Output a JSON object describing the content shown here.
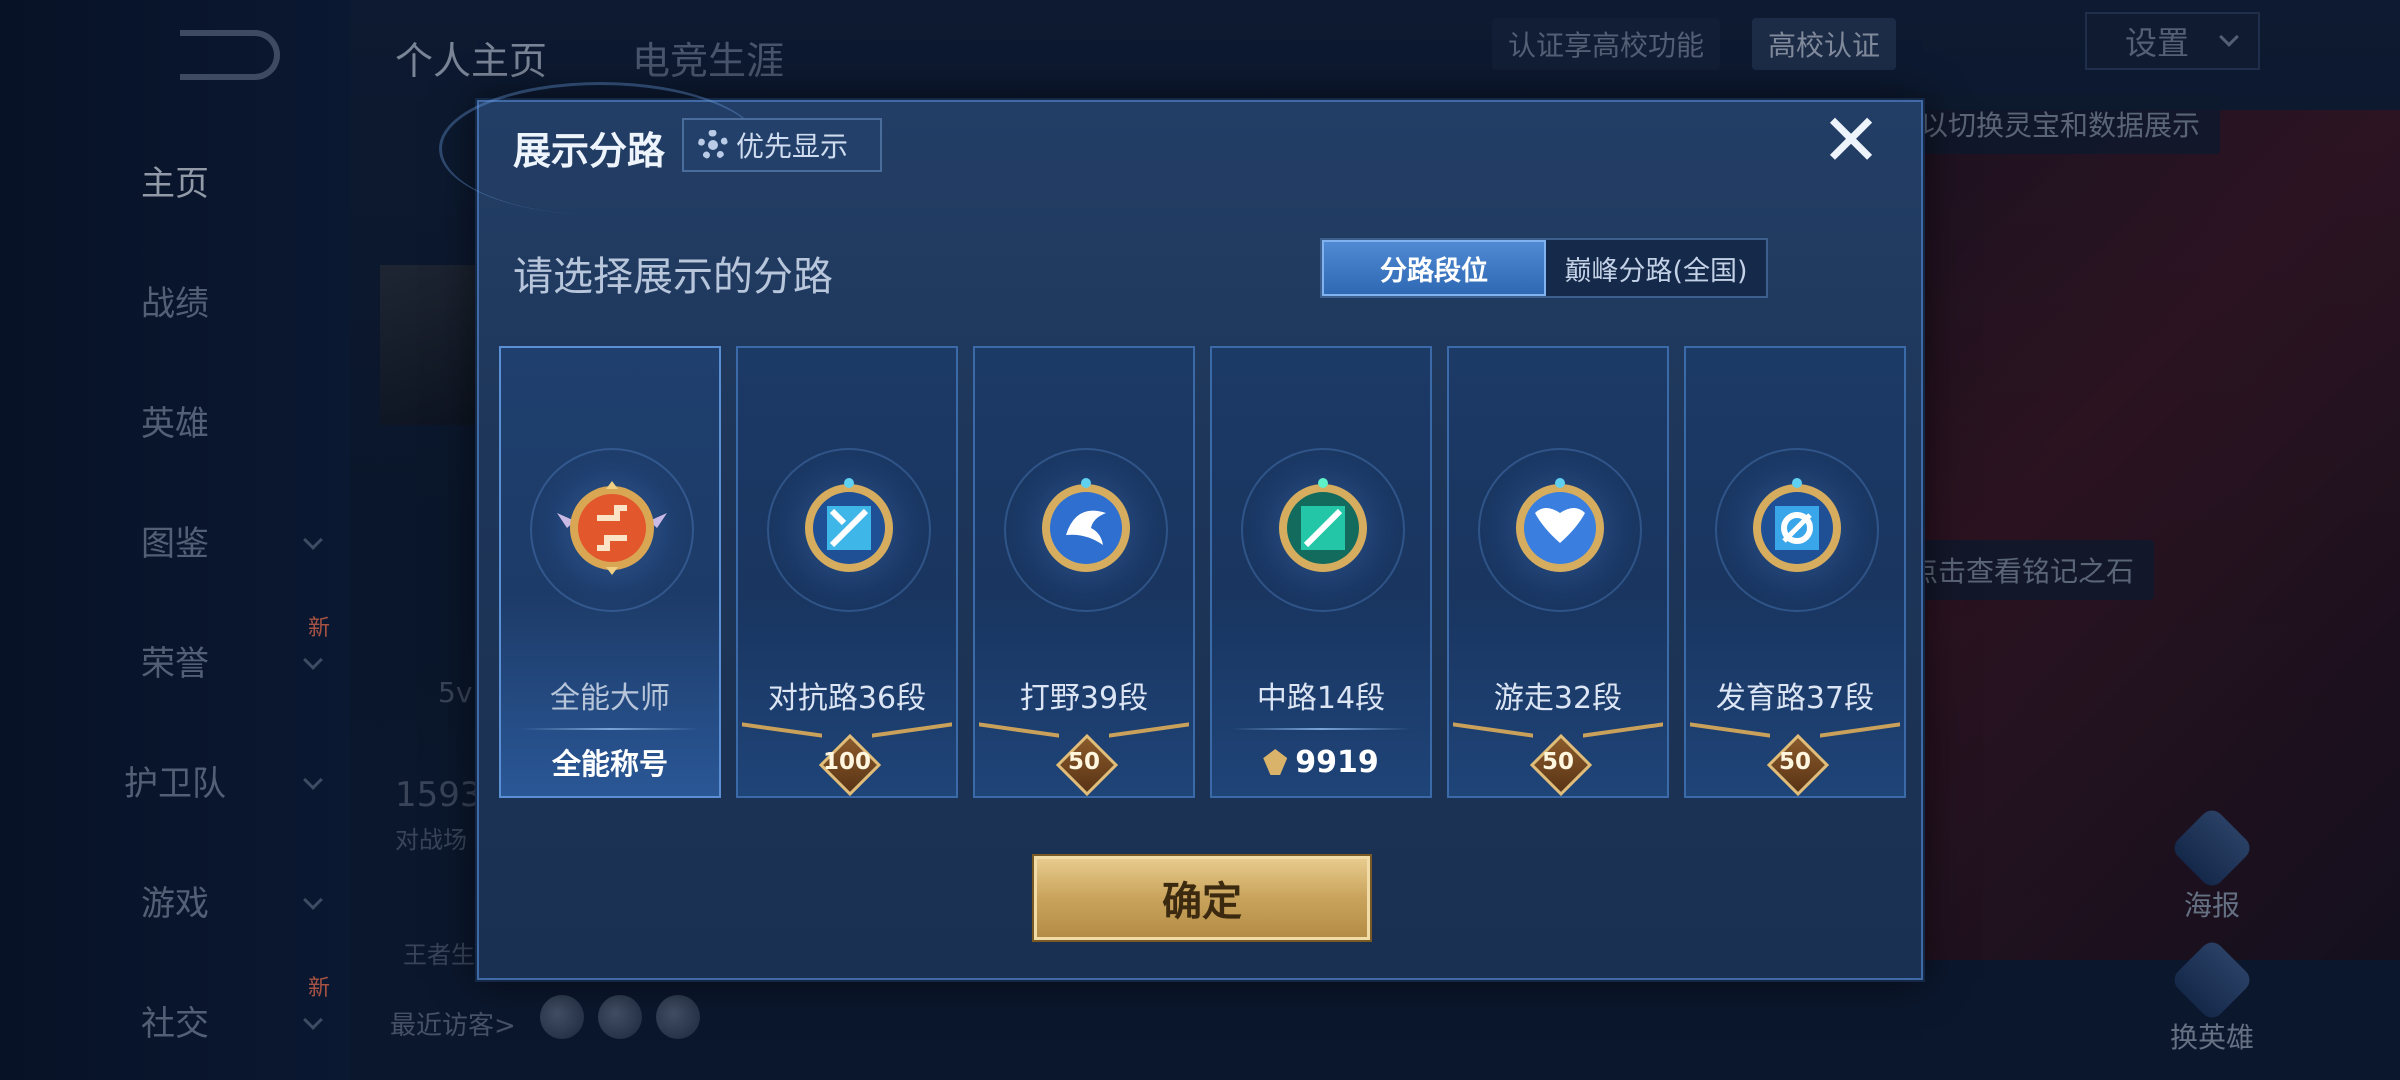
{
  "background": {
    "top_tabs": [
      "个人主页",
      "电竞生涯"
    ],
    "sidebar": [
      {
        "label": "主页",
        "expandable": false,
        "new": false
      },
      {
        "label": "战绩",
        "expandable": false,
        "new": false
      },
      {
        "label": "英雄",
        "expandable": false,
        "new": false
      },
      {
        "label": "图鉴",
        "expandable": true,
        "new": false
      },
      {
        "label": "荣誉",
        "expandable": true,
        "new": true
      },
      {
        "label": "护卫队",
        "expandable": true,
        "new": false
      },
      {
        "label": "游戏",
        "expandable": true,
        "new": false
      },
      {
        "label": "社交",
        "expandable": true,
        "new": true
      }
    ],
    "new_tag": "新",
    "campus_prompt": "认证享高校功能",
    "campus_btn": "高校认证",
    "settings": "设置",
    "hint_switch": "以切换灵宝和数据展示",
    "hint_inscription": "点击查看铭记之石",
    "mode_text": "5v",
    "stat_number": "1593",
    "stat_label": "对战场",
    "bottom_label": "王者生",
    "recent_visitors": "最近访客>",
    "poster": "海报",
    "change_hero": "换英雄"
  },
  "dialog": {
    "title": "展示分路",
    "priority_label": "优先显示",
    "close": "✕",
    "subtitle": "请选择展示的分路",
    "tabs": [
      {
        "label": "分路段位",
        "active": true
      },
      {
        "label": "巅峰分路(全国)",
        "active": false
      }
    ],
    "cards": [
      {
        "name": "全能大师",
        "footer_type": "title",
        "footer": "全能称号",
        "badge_color": "#e2572c"
      },
      {
        "name": "对抗路36段",
        "footer_type": "stars",
        "footer": "100",
        "badge_color": "#3fb6e8"
      },
      {
        "name": "打野39段",
        "footer_type": "stars",
        "footer": "50",
        "badge_color": "#2f6fd0"
      },
      {
        "name": "中路14段",
        "footer_type": "points",
        "footer": "9919",
        "badge_color": "#23c7a8"
      },
      {
        "name": "游走32段",
        "footer_type": "stars",
        "footer": "50",
        "badge_color": "#3a7fe0"
      },
      {
        "name": "发育路37段",
        "footer_type": "stars",
        "footer": "50",
        "badge_color": "#3aa6ea"
      }
    ],
    "confirm": "确定"
  }
}
